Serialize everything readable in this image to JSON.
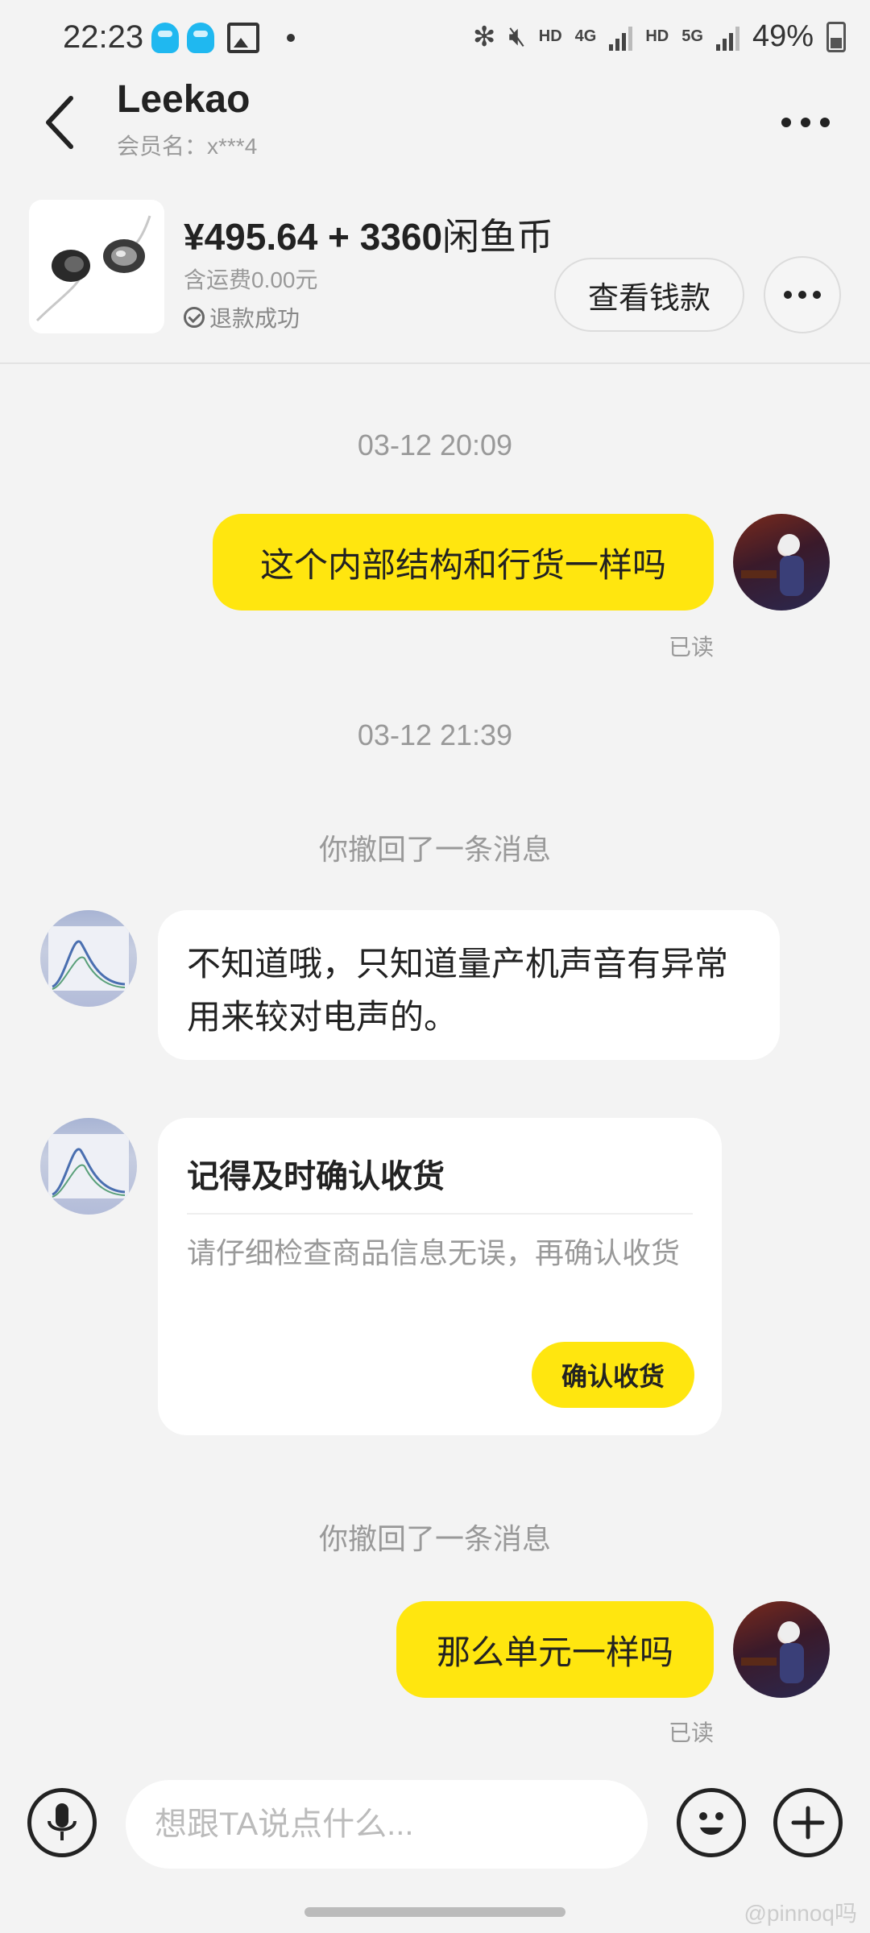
{
  "status_bar": {
    "time": "22:23",
    "hd1": "HD",
    "net1": "4G",
    "hd2": "HD",
    "net2": "5G",
    "battery": "49%"
  },
  "header": {
    "title": "Leekao",
    "subtitle": "会员名：x***4"
  },
  "product": {
    "price": "¥495.64 + 3360",
    "coin_label": "闲鱼币",
    "shipping": "含运费0.00元",
    "status": "退款成功",
    "view_payment_label": "查看钱款"
  },
  "chat": {
    "timestamp_1": "03-12 20:09",
    "msg_1": "这个内部结构和行货一样吗",
    "read_1": "已读",
    "timestamp_2": "03-12 21:39",
    "recall_1": "你撤回了一条消息",
    "seller_msg_1": "不知道哦，只知道量产机声音有异常用来较对电声的。",
    "confirm_card": {
      "title": "记得及时确认收货",
      "description": "请仔细检查商品信息无误，再确认收货",
      "button": "确认收货"
    },
    "recall_2": "你撤回了一条消息",
    "msg_2": "那么单元一样吗",
    "read_2": "已读"
  },
  "input": {
    "placeholder": "想跟TA说点什么..."
  },
  "watermark": "@pinnoq吗",
  "colors": {
    "accent_yellow": "#ffe60f",
    "background": "#f3f3f3",
    "qq_blue": "#1fb8f0"
  }
}
